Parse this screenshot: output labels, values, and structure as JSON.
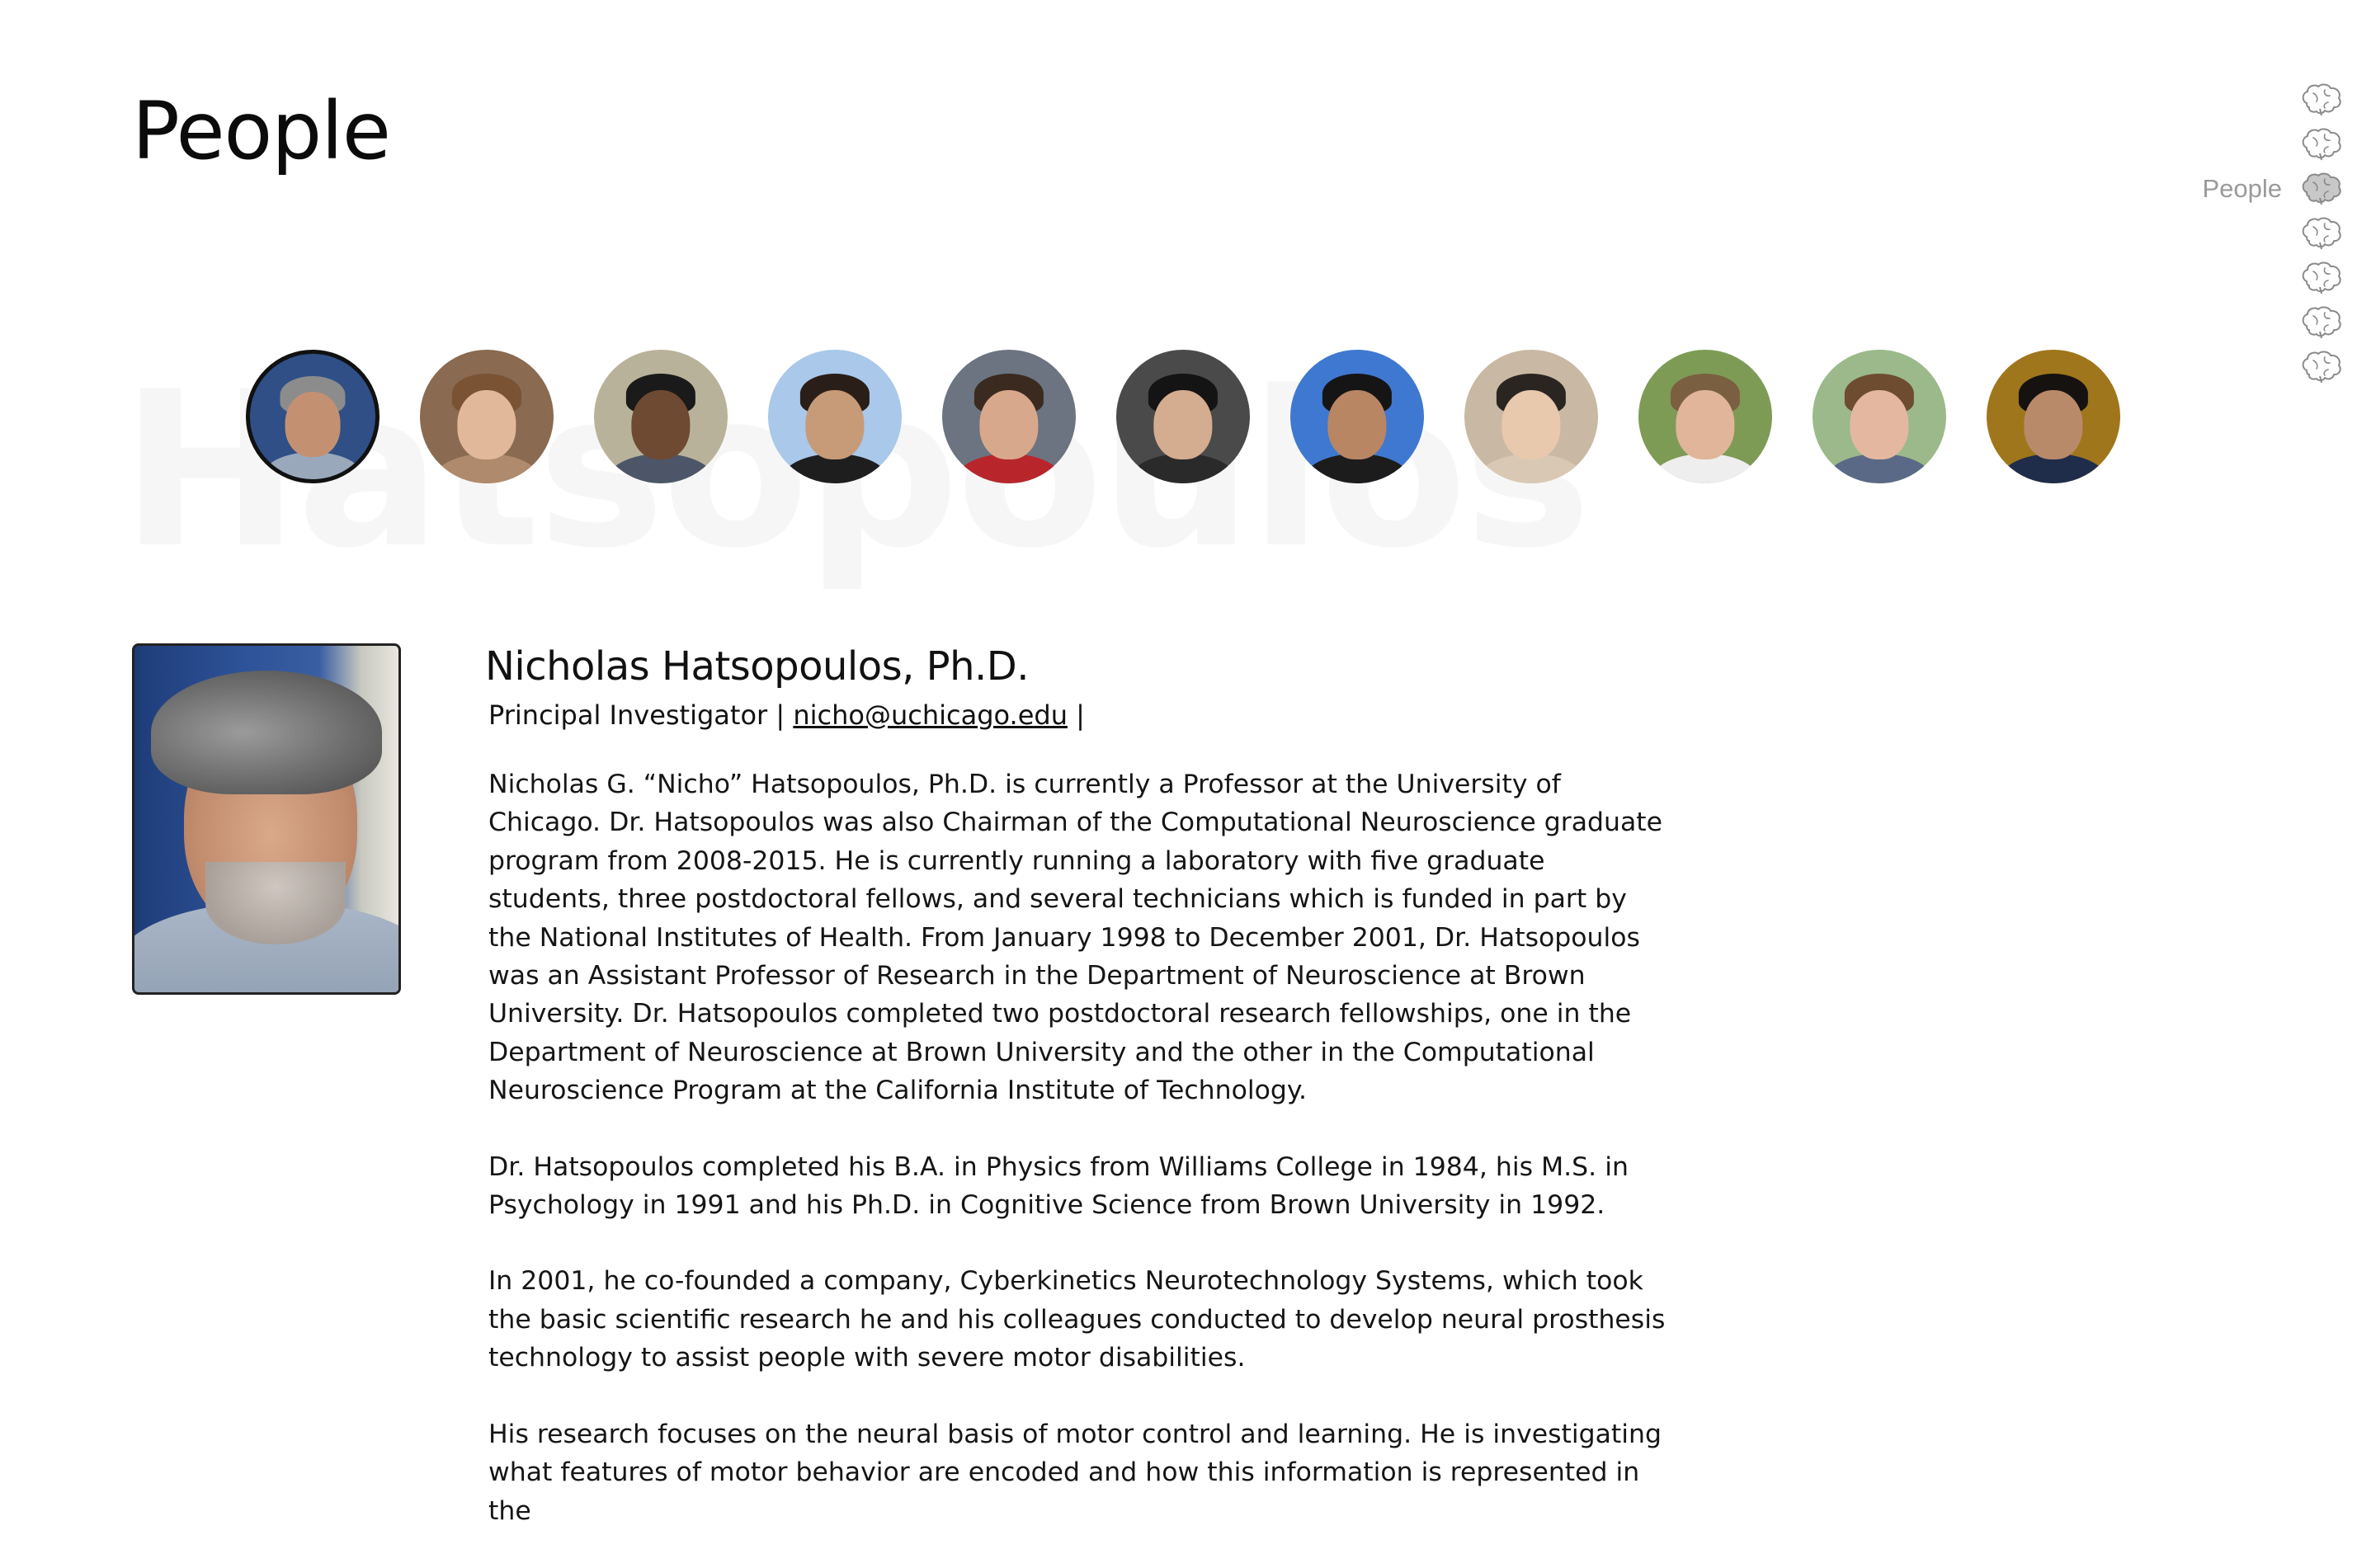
{
  "page": {
    "title": "People",
    "watermark": "Hatsopoulos"
  },
  "side_nav": {
    "items": [
      {
        "label": "",
        "icon": "brain-icon",
        "active": false
      },
      {
        "label": "",
        "icon": "brain-icon",
        "active": false
      },
      {
        "label": "People",
        "icon": "brain-icon",
        "active": true
      },
      {
        "label": "",
        "icon": "brain-icon",
        "active": false
      },
      {
        "label": "",
        "icon": "brain-icon",
        "active": false
      },
      {
        "label": "",
        "icon": "brain-icon",
        "active": false
      },
      {
        "label": "",
        "icon": "brain-icon",
        "active": false
      }
    ],
    "colors": {
      "outline": "#8a8a8a",
      "active_fill": "#c8c8c8"
    }
  },
  "people_carousel": {
    "avatars": [
      {
        "selected": true,
        "bg": "#2f4f86",
        "skin": "#c49072",
        "hair": "#8c8c8c",
        "cloth": "#9aa8bc"
      },
      {
        "selected": false,
        "bg": "#8a6a50",
        "skin": "#e2b89a",
        "hair": "#7a5234",
        "cloth": "#b08a6c"
      },
      {
        "selected": false,
        "bg": "#b9b29a",
        "skin": "#6e4a32",
        "hair": "#1a1a1a",
        "cloth": "#4c5668"
      },
      {
        "selected": false,
        "bg": "#a9c8ea",
        "skin": "#c79a78",
        "hair": "#2a1e18",
        "cloth": "#1e1e1e"
      },
      {
        "selected": false,
        "bg": "#6b7480",
        "skin": "#d8a88c",
        "hair": "#3b2a20",
        "cloth": "#b8262c"
      },
      {
        "selected": false,
        "bg": "#4a4a4a",
        "skin": "#d4ac90",
        "hair": "#141414",
        "cloth": "#2a2a2a"
      },
      {
        "selected": false,
        "bg": "#3f78d0",
        "skin": "#b98664",
        "hair": "#151515",
        "cloth": "#1c1c1c"
      },
      {
        "selected": false,
        "bg": "#c9b9a4",
        "skin": "#e9c9ae",
        "hair": "#2b2522",
        "cloth": "#d9c8b4"
      },
      {
        "selected": false,
        "bg": "#7e9b56",
        "skin": "#e1b59a",
        "hair": "#7a6040",
        "cloth": "#eeeeee"
      },
      {
        "selected": false,
        "bg": "#9bb98a",
        "skin": "#e4b8a0",
        "hair": "#6e4c30",
        "cloth": "#5a6a86"
      },
      {
        "selected": false,
        "bg": "#a0761c",
        "skin": "#b98a6a",
        "hair": "#161210",
        "cloth": "#1f2c4a"
      }
    ]
  },
  "profile": {
    "name": "Nicholas Hatsopoulos, Ph.D.",
    "role": "Principal Investigator",
    "separator": "|",
    "email": "nicho@uchicago.edu",
    "trailing_separator": "|",
    "photo_icon": "portrait-photo",
    "bio": [
      "Nicholas G. “Nicho” Hatsopoulos, Ph.D. is currently a Professor at the University of Chicago. Dr. Hatsopoulos was also Chairman of the Computational Neuroscience graduate program from 2008-2015. He is currently running a laboratory with five graduate students, three postdoctoral fellows, and several technicians which is funded in part by the National Institutes of Health. From January 1998 to December 2001, Dr. Hatsopoulos was an Assistant Professor of Research in the Department of Neuroscience at Brown University. Dr. Hatsopoulos completed two postdoctoral research fellowships, one in the Department of Neuroscience at Brown University and the other in the Computational Neuroscience Program at the California Institute of Technology.",
      "Dr. Hatsopoulos completed his B.A. in Physics from Williams College in 1984, his M.S. in Psychology in 1991 and his Ph.D. in Cognitive Science from Brown University in 1992.",
      "In 2001, he co-founded a company, Cyberkinetics Neurotechnology Systems, which took the basic scientific research he and his colleagues conducted to develop neural prosthesis technology to assist people with severe motor disabilities.",
      "His research focuses on the neural basis of motor control and learning. He is investigating what features of motor behavior are encoded and how this information is represented in the"
    ]
  }
}
